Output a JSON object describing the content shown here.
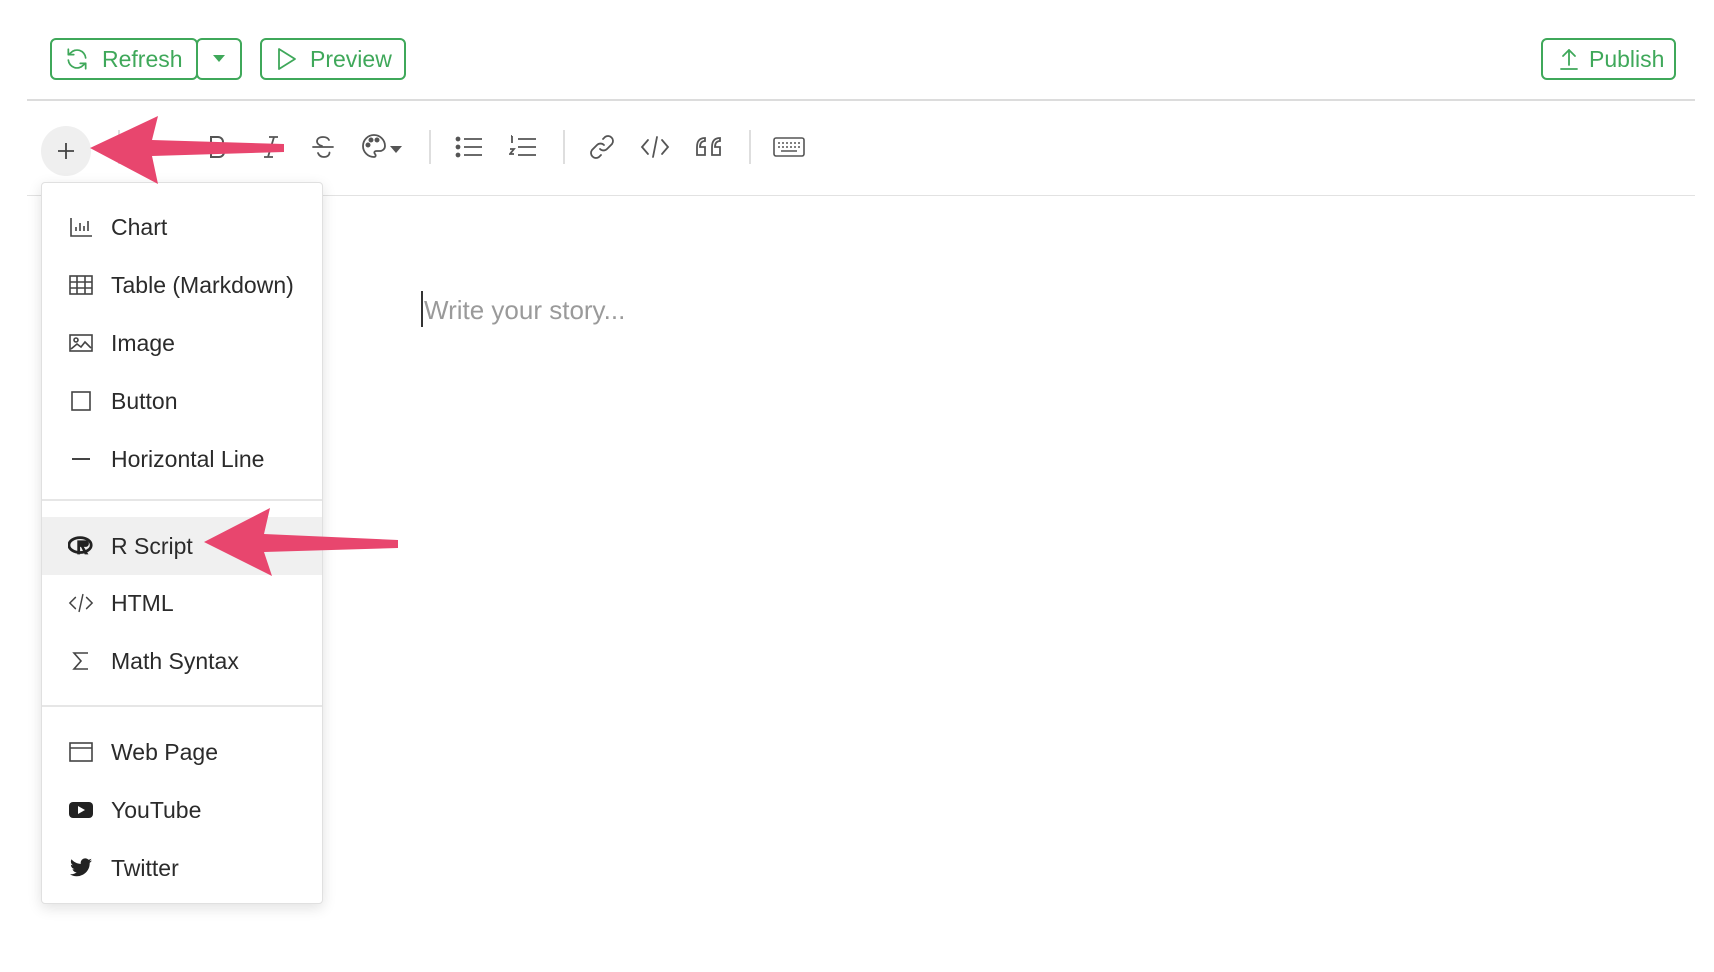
{
  "header": {
    "refresh_label": "Refresh",
    "preview_label": "Preview",
    "publish_label": "Publish"
  },
  "toolbar": {
    "icons": [
      "plus-icon",
      "bold-icon",
      "italic-icon",
      "strikethrough-icon",
      "palette-icon",
      "bullet-list-icon",
      "numbered-list-icon",
      "link-icon",
      "code-icon",
      "quote-icon",
      "keyboard-icon"
    ]
  },
  "editor": {
    "placeholder": "Write your story..."
  },
  "insert_menu": {
    "items": [
      {
        "label": "Chart",
        "icon": "chart-icon"
      },
      {
        "label": "Table (Markdown)",
        "icon": "table-icon"
      },
      {
        "label": "Image",
        "icon": "image-icon"
      },
      {
        "label": "Button",
        "icon": "button-icon"
      },
      {
        "label": "Horizontal Line",
        "icon": "horizontal-line-icon"
      },
      {
        "label": "R Script",
        "icon": "r-logo-icon",
        "highlighted": true
      },
      {
        "label": "HTML",
        "icon": "code-icon"
      },
      {
        "label": "Math Syntax",
        "icon": "sigma-icon"
      },
      {
        "label": "Web Page",
        "icon": "browser-window-icon"
      },
      {
        "label": "YouTube",
        "icon": "youtube-icon"
      },
      {
        "label": "Twitter",
        "icon": "twitter-icon"
      }
    ]
  },
  "colors": {
    "accent_green": "#3fa85a",
    "annotation_arrow": "#e8466e"
  }
}
